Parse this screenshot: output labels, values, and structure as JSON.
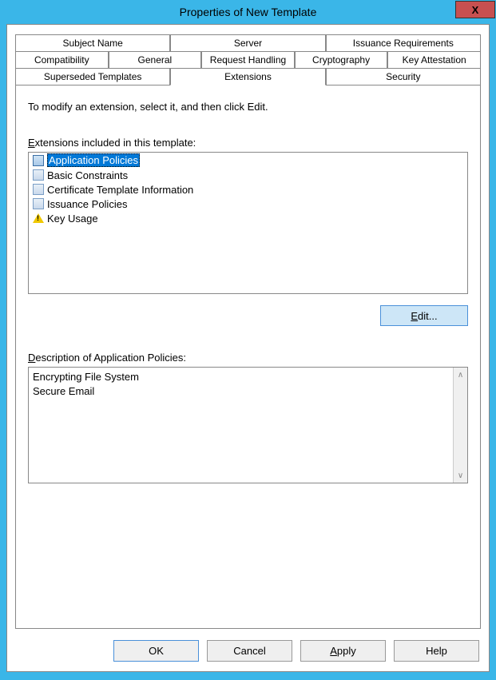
{
  "window": {
    "title": "Properties of New Template",
    "close": "X"
  },
  "tabs_row1": [
    {
      "label": "Subject Name"
    },
    {
      "label": "Server"
    },
    {
      "label": "Issuance Requirements"
    }
  ],
  "tabs_row2": [
    {
      "label": "Compatibility"
    },
    {
      "label": "General"
    },
    {
      "label": "Request Handling"
    },
    {
      "label": "Cryptography"
    },
    {
      "label": "Key Attestation"
    }
  ],
  "tabs_row3": [
    {
      "label": "Superseded Templates"
    },
    {
      "label": "Extensions"
    },
    {
      "label": "Security"
    }
  ],
  "content": {
    "instruction": "To modify an extension, select it, and then click Edit.",
    "list_label_prefix": "E",
    "list_label": "xtensions included in this template:",
    "items": [
      {
        "text": "Application Policies",
        "icon": "doc-icon",
        "selected": true,
        "warn": false
      },
      {
        "text": "Basic Constraints",
        "icon": "doc-icon",
        "selected": false,
        "warn": false
      },
      {
        "text": "Certificate Template Information",
        "icon": "doc-icon",
        "selected": false,
        "warn": false
      },
      {
        "text": "Issuance Policies",
        "icon": "doc-icon",
        "selected": false,
        "warn": false
      },
      {
        "text": "Key Usage",
        "icon": "warning-icon",
        "selected": false,
        "warn": true
      }
    ],
    "edit_prefix": "E",
    "edit_label": "dit...",
    "desc_label_prefix": "D",
    "desc_label": "escription of Application Policies:",
    "desc_lines": [
      "Encrypting File System",
      "Secure Email"
    ]
  },
  "buttons": {
    "ok": "OK",
    "cancel": "Cancel",
    "apply_prefix": "A",
    "apply": "pply",
    "help": "Help"
  }
}
